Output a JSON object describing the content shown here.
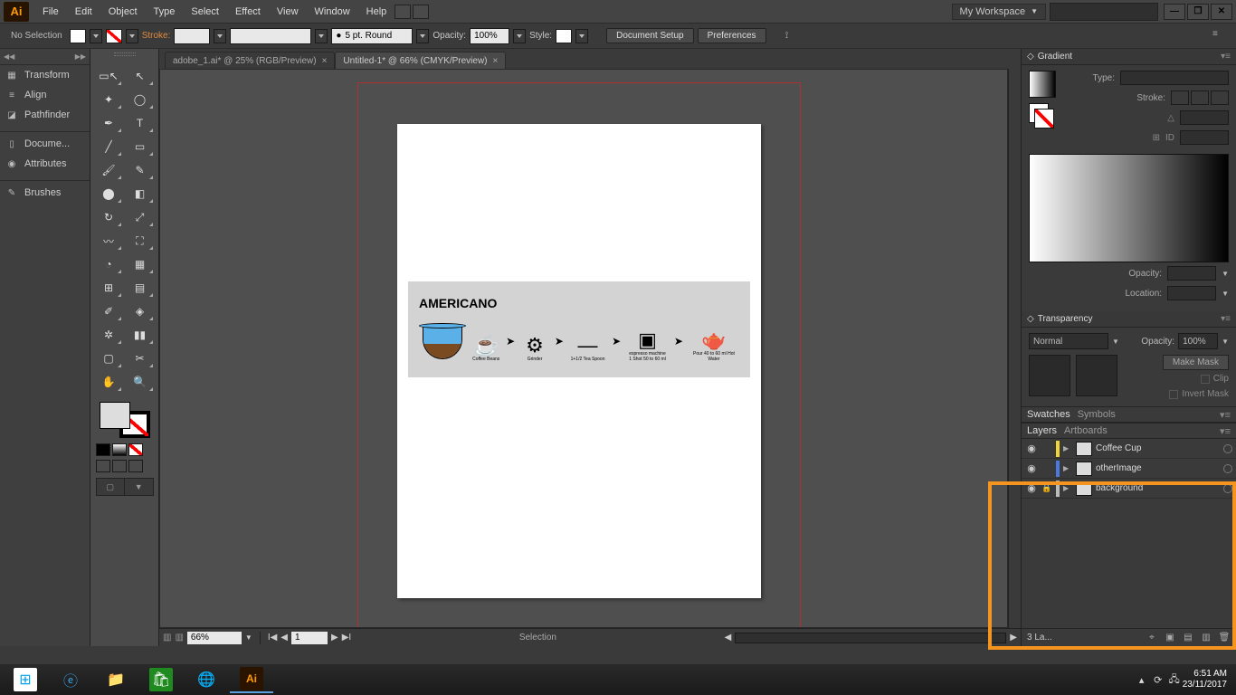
{
  "menubar": {
    "items": [
      "File",
      "Edit",
      "Object",
      "Type",
      "Select",
      "Effect",
      "View",
      "Window",
      "Help"
    ],
    "workspace": "My Workspace"
  },
  "controlbar": {
    "selection": "No Selection",
    "stroke_label": "Stroke:",
    "brush_label": "5 pt. Round",
    "opacity_label": "Opacity:",
    "opacity_value": "100%",
    "style_label": "Style:",
    "doc_setup": "Document Setup",
    "preferences": "Preferences"
  },
  "left_panels": {
    "items": [
      "Transform",
      "Align",
      "Pathfinder",
      "Docume...",
      "Attributes",
      "Brushes"
    ]
  },
  "tabs": [
    {
      "label": "adobe_1.ai* @ 25% (RGB/Preview)"
    },
    {
      "label": "Untitled-1* @ 66% (CMYK/Preview)"
    }
  ],
  "statusbar": {
    "zoom": "66%",
    "page": "1",
    "mode": "Selection"
  },
  "artwork": {
    "title": "AMERICANO",
    "steps": [
      {
        "glyph": "cup",
        "label": ""
      },
      {
        "glyph": "beans",
        "label": "Coffee Beans"
      },
      {
        "glyph": "grinder",
        "label": "Grinder"
      },
      {
        "glyph": "spoon",
        "label": "1+1/2 Tea Spoon"
      },
      {
        "glyph": "machine",
        "label": "espresso machine\n1 Shot 50 to 60 ml"
      },
      {
        "glyph": "kettle",
        "label": "Pour 40 to 60 ml Hot Water"
      }
    ]
  },
  "right": {
    "gradient": {
      "title": "Gradient",
      "type_label": "Type:",
      "stroke_label": "Stroke:",
      "opacity_label": "Opacity:",
      "location_label": "Location:"
    },
    "transparency": {
      "title": "Transparency",
      "blend": "Normal",
      "opacity_label": "Opacity:",
      "opacity_value": "100%",
      "make_mask": "Make Mask",
      "clip": "Clip",
      "invert": "Invert Mask"
    },
    "swatches": {
      "tab1": "Swatches",
      "tab2": "Symbols"
    },
    "layers": {
      "tab1": "Layers",
      "tab2": "Artboards",
      "rows": [
        {
          "name": "Coffee Cup",
          "locked": false,
          "color": "#f2d33a"
        },
        {
          "name": "otherImage",
          "locked": false,
          "color": "#4a7ae0"
        },
        {
          "name": "background",
          "locked": true,
          "color": "#bbbbbb"
        }
      ],
      "count": "3 La..."
    }
  },
  "taskbar": {
    "time": "6:51 AM",
    "date": "23/11/2017"
  }
}
